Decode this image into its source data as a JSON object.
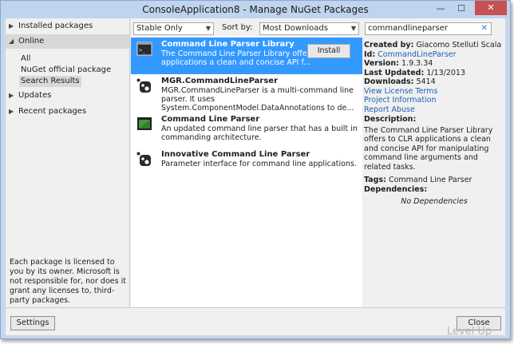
{
  "window": {
    "title": "ConsoleApplication8 - Manage NuGet Packages",
    "minimize_icon": "—",
    "maximize_icon": "☐",
    "close_icon": "✕"
  },
  "sidebar": {
    "installed": "Installed packages",
    "online": "Online",
    "online_items": [
      "All",
      "NuGet official package source",
      "Search Results"
    ],
    "updates": "Updates",
    "recent": "Recent packages",
    "collapsed_arrow": "▶",
    "expanded_arrow": "◢",
    "notice": "Each package is licensed to you by its owner. Microsoft is not responsible for, nor does it grant any licenses to, third-party packages."
  },
  "toolbar": {
    "filter": "Stable Only",
    "sort_label": "Sort by:",
    "sort_value": "Most Downloads"
  },
  "search": {
    "value": "commandlineparser",
    "clear_icon": "✕"
  },
  "packages": [
    {
      "title": "Command Line Parser Library",
      "desc": "The Command Line Parser Library offers to CLR applications a clean and concise API f...",
      "install": "Install"
    },
    {
      "title": "MGR.CommandLineParser",
      "desc": "MGR.CommandLineParser is a multi-command line parser. It uses System.ComponentModel.DataAnnotations to de..."
    },
    {
      "title": "Command Line Parser",
      "desc": "An updated command line parser that has a built in commanding architecture."
    },
    {
      "title": "Innovative Command Line Parser",
      "desc": "Parameter interface for command line applications."
    }
  ],
  "page_number": "1",
  "details": {
    "created_by_label": "Created by:",
    "created_by": "Giacomo Stelluti Scala",
    "id_label": "Id:",
    "id": "CommandLineParser",
    "version_label": "Version:",
    "version": "1.9.3.34",
    "last_updated_label": "Last Updated:",
    "last_updated": "1/13/2013",
    "downloads_label": "Downloads:",
    "downloads": "5414",
    "view_license": "View License Terms",
    "project_info": "Project Information",
    "report_abuse": "Report Abuse",
    "description_label": "Description:",
    "description": "The Command Line Parser Library offers to CLR applications a clean and concise API for manipulating command line arguments and related tasks.",
    "tags_label": "Tags:",
    "tags": "Command Line Parser",
    "dependencies_label": "Dependencies:",
    "no_dependencies": "No Dependencies"
  },
  "buttons": {
    "settings": "Settings",
    "close": "Close"
  },
  "watermark": "Level Up"
}
